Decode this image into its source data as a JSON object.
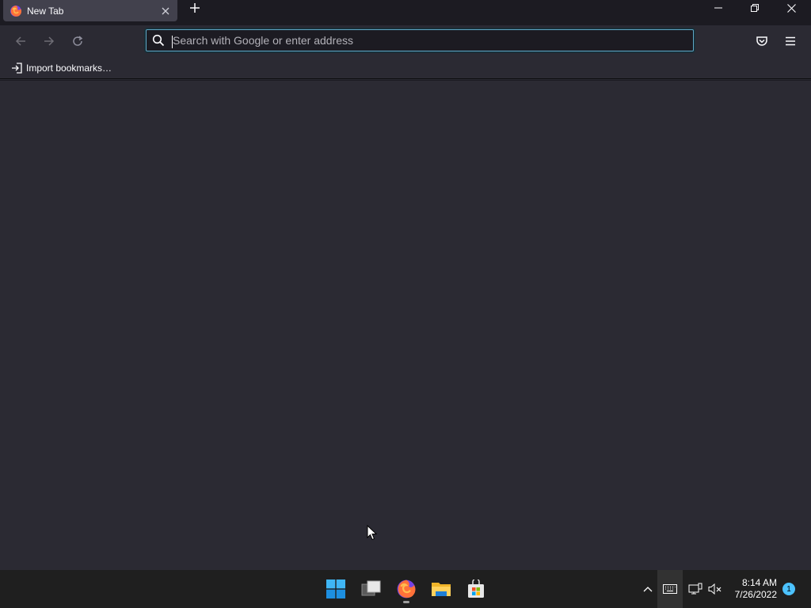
{
  "browser": {
    "tab": {
      "title": "New Tab",
      "favicon": "firefox-icon",
      "close_icon": "close-icon"
    },
    "new_tab_icon": "plus-icon",
    "window_controls": [
      "minimize-icon",
      "restore-icon",
      "close-icon"
    ]
  },
  "navbar": {
    "back_icon": "arrow-left-icon",
    "forward_icon": "arrow-right-icon",
    "reload_icon": "reload-icon",
    "urlbar": {
      "placeholder": "Search with Google or enter address",
      "value": "",
      "search_icon": "search-icon"
    },
    "pocket_icon": "pocket-icon",
    "menu_icon": "hamburger-menu-icon"
  },
  "bookmarks": {
    "import_label": "Import bookmarks…",
    "import_icon": "import-icon"
  },
  "taskbar": {
    "apps": [
      "windows-start-icon",
      "task-view-icon",
      "firefox-icon",
      "file-explorer-icon",
      "microsoft-store-icon"
    ],
    "tray": {
      "chevron_icon": "chevron-up-icon",
      "keyboard_icon": "keyboard-icon",
      "network_icon": "network-icon",
      "volume_icon": "volume-muted-icon"
    },
    "clock": {
      "time": "8:14 AM",
      "date": "7/26/2022"
    },
    "notification_count": "1"
  },
  "colors": {
    "tabstrip_bg": "#1c1b22",
    "toolbar_bg": "#2b2a33",
    "urlbar_bg": "#1c1b22",
    "urlbar_focus": "#5fa8c7",
    "taskbar_bg": "#1f1f1f",
    "accent": "#4cc2ff"
  }
}
